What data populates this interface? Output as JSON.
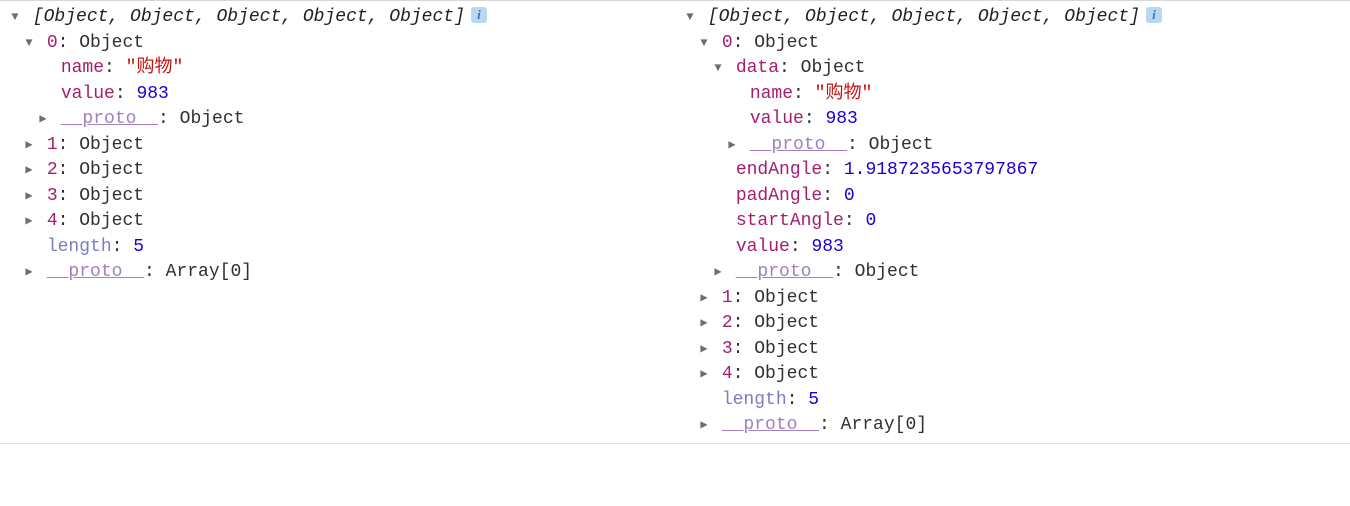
{
  "left": {
    "summary": "[Object, Object, Object, Object, Object]",
    "expanded": {
      "index": "0",
      "type": "Object",
      "props": [
        {
          "key": "name",
          "kind": "str",
          "value": "\"购物\""
        },
        {
          "key": "value",
          "kind": "num",
          "value": "983"
        }
      ],
      "proto": "Object"
    },
    "rest": [
      "1",
      "2",
      "3",
      "4"
    ],
    "length": "5",
    "arrayProto": "Array[0]"
  },
  "right": {
    "summary": "[Object, Object, Object, Object, Object]",
    "expanded": {
      "index": "0",
      "type": "Object",
      "data": {
        "key": "data",
        "type": "Object",
        "props": [
          {
            "key": "name",
            "kind": "str",
            "value": "\"购物\""
          },
          {
            "key": "value",
            "kind": "num",
            "value": "983"
          }
        ],
        "proto": "Object"
      },
      "extra": [
        {
          "key": "endAngle",
          "kind": "num",
          "value": "1.9187235653797867"
        },
        {
          "key": "padAngle",
          "kind": "num",
          "value": "0"
        },
        {
          "key": "startAngle",
          "kind": "num",
          "value": "0"
        },
        {
          "key": "value",
          "kind": "num",
          "value": "983"
        }
      ],
      "proto": "Object"
    },
    "rest": [
      "1",
      "2",
      "3",
      "4"
    ],
    "length": "5",
    "arrayProto": "Array[0]"
  },
  "glyph": {
    "right": "▶",
    "down": "▼",
    "colon": ": ",
    "objword": "Object",
    "lenword": "length",
    "protoword": "__proto__"
  }
}
